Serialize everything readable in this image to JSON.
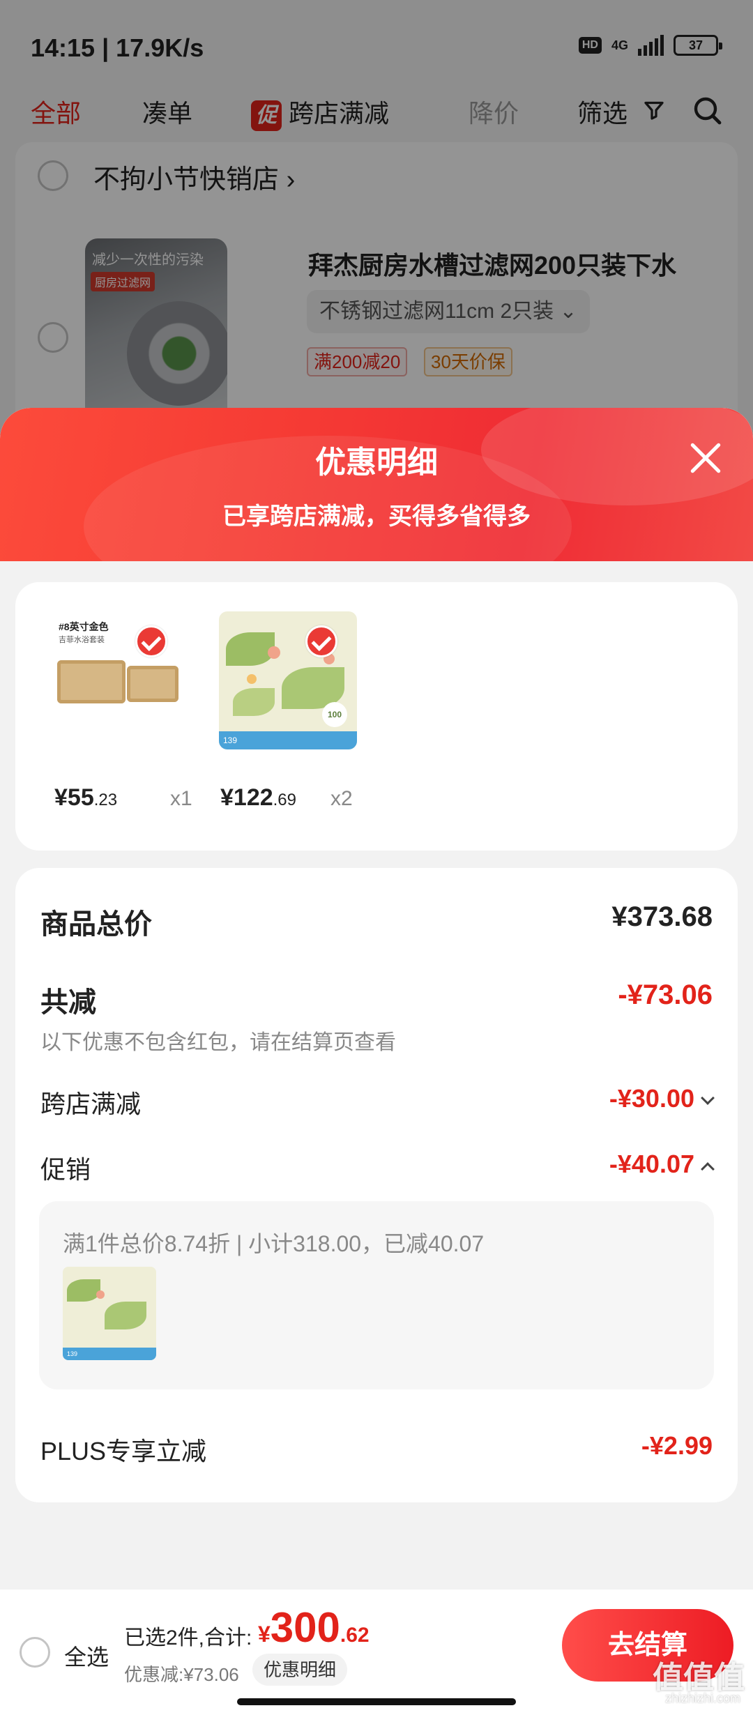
{
  "status_bar": {
    "time_speed": "14:15 | 17.9K/s",
    "hd": "HD",
    "network": "4G",
    "battery": "37"
  },
  "tabs": {
    "all": "全部",
    "combine": "凑单",
    "promo_badge": "促",
    "cross_store": "跨店满减",
    "price_drop": "降价",
    "filter": "筛选"
  },
  "shop": {
    "name": "不拘小节快销店",
    "product_title": "拜杰厨房水槽过滤网200只装下水",
    "sku": "不锈钢过滤网11cm 2只装",
    "thumb_text_1": "减少一次性的污染",
    "thumb_text_2": "厨房过滤网",
    "tags": [
      "满200减20",
      "30天价保"
    ]
  },
  "sheet": {
    "title": "优惠明细",
    "subtitle": "已享跨店满减，买得多省得多"
  },
  "items": [
    {
      "img_title": "#8英寸金色",
      "img_sub": "吉菲水浴套装",
      "price_int": "¥55",
      "price_dec": ".23",
      "qty": "x1"
    },
    {
      "img_strip": "139",
      "img_badge": "100",
      "price_int": "¥122",
      "price_dec": ".69",
      "qty": "x2"
    }
  ],
  "summary": {
    "goods_total_label": "商品总价",
    "goods_total_value": "¥373.68",
    "total_discount_label": "共减",
    "total_discount_value": "-¥73.06",
    "note": "以下优惠不包含红包，请在结算页查看",
    "cross_store_label": "跨店满减",
    "cross_store_value": "-¥30.00",
    "promo_label": "促销",
    "promo_value": "-¥40.07",
    "promo_detail": "满1件总价8.74折 | 小计318.00，已减40.07",
    "plus_label": "PLUS专享立减",
    "plus_value": "-¥2.99"
  },
  "bottom_bar": {
    "select_all": "全选",
    "selected_prefix": "已选2件,合计:",
    "total_currency": "¥",
    "total_int": "300",
    "total_dec": ".62",
    "discount": "优惠减:¥73.06",
    "detail_button": "优惠明细",
    "checkout": "去结算"
  },
  "watermark": {
    "main": "值值值",
    "sub": "zhizhizhi.com"
  },
  "colors": {
    "accent": "#e2231a",
    "sheet_header": "#f53a34"
  }
}
